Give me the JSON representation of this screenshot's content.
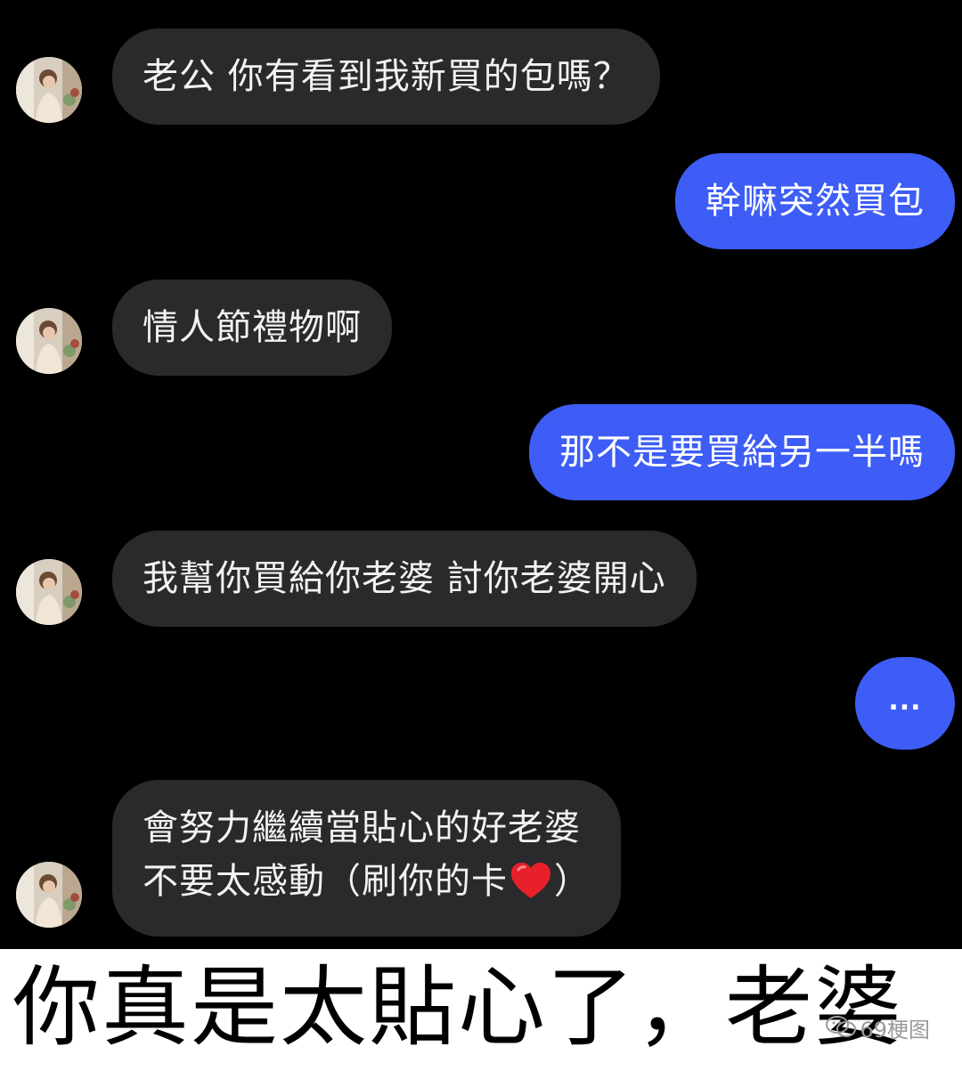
{
  "messages": [
    {
      "side": "incoming",
      "text": "老公 你有看到我新買的包嗎？"
    },
    {
      "side": "outgoing",
      "text": "幹嘛突然買包"
    },
    {
      "side": "incoming",
      "text": "情人節禮物啊"
    },
    {
      "side": "outgoing",
      "text": "那不是要買給另一半嗎"
    },
    {
      "side": "incoming",
      "text": "我幫你買給你老婆 討你老婆開心"
    },
    {
      "side": "outgoing",
      "text": "..."
    },
    {
      "side": "incoming",
      "lines": [
        "會努力繼續當貼心的好老婆",
        "不要太感動（刷你的卡",
        "）"
      ]
    }
  ],
  "caption": "你真是太貼心了，老婆",
  "watermark": "69梗图",
  "colors": {
    "background": "#000000",
    "incoming_bubble": "#2a2a2c",
    "outgoing_bubble": "#3d5df6",
    "caption_bar": "#ffffff"
  },
  "icons": {
    "avatar": "avatar-photo",
    "emoji": "red-heart-icon",
    "watermark": "wechat-icon"
  }
}
